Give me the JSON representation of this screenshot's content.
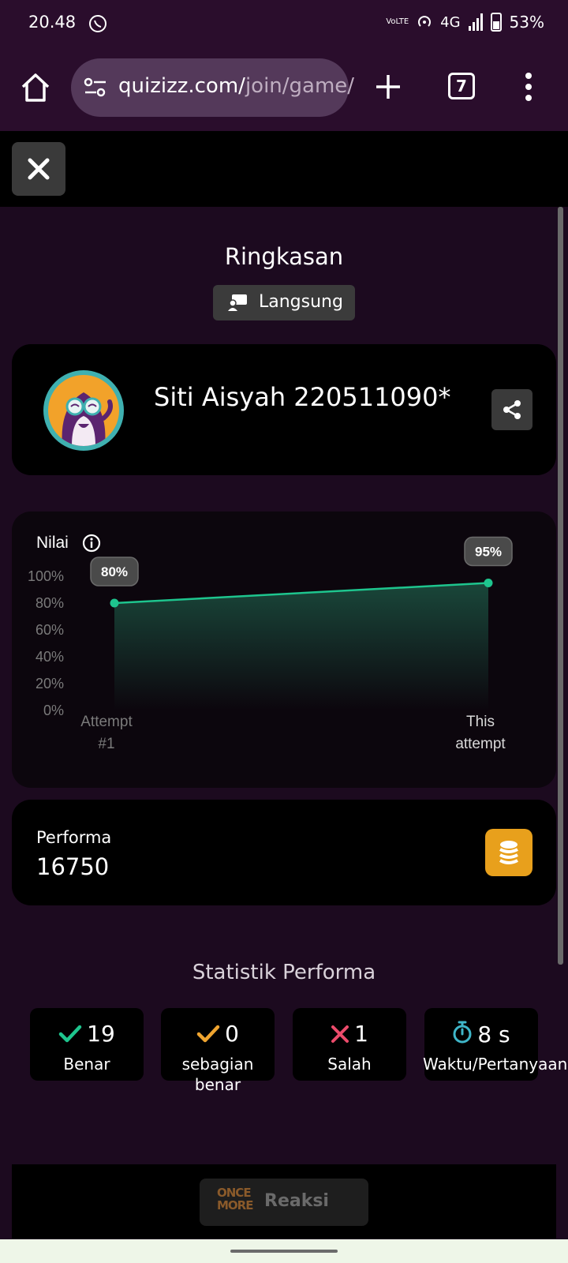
{
  "status_bar": {
    "time": "20.48",
    "network": "4G",
    "battery": "53%",
    "volte": "VoLTE"
  },
  "browser": {
    "url_domain": "quizizz.com/",
    "url_path": "join/game/",
    "tab_count": "7"
  },
  "page": {
    "title": "Ringkasan",
    "mode_badge": "Langsung",
    "user_name": "Siti Aisyah 220511090*"
  },
  "chart_data": {
    "type": "area",
    "title": "Nilai",
    "categories": [
      "Attempt #1",
      "This attempt"
    ],
    "series": [
      {
        "values": [
          80,
          95
        ]
      }
    ],
    "data_labels": [
      "80%",
      "95%"
    ],
    "y_ticks": [
      "100%",
      "80%",
      "60%",
      "40%",
      "20%",
      "0%"
    ],
    "ylim": [
      0,
      100
    ],
    "colors": {
      "line": "#1ec58e",
      "fill_top": "#1a4a3c"
    }
  },
  "performance": {
    "label": "Performa",
    "value": "16750"
  },
  "stats": {
    "title": "Statistik Performa",
    "items": [
      {
        "value": "19",
        "label": "Benar",
        "icon": "check-icon",
        "color": "#1ec58e"
      },
      {
        "value": "0",
        "label": "sebagian benar",
        "icon": "check-icon",
        "color": "#f0a530"
      },
      {
        "value": "1",
        "label": "Salah",
        "icon": "cross-icon",
        "color": "#ec4b6b"
      },
      {
        "value": "8 s",
        "label": "Waktu/Pertanyaan",
        "icon": "stopwatch-icon",
        "color": "#3fb6c9"
      }
    ]
  },
  "footer": {
    "reaction_logo": "ONCE MORE",
    "reaction_label": "Reaksi"
  }
}
